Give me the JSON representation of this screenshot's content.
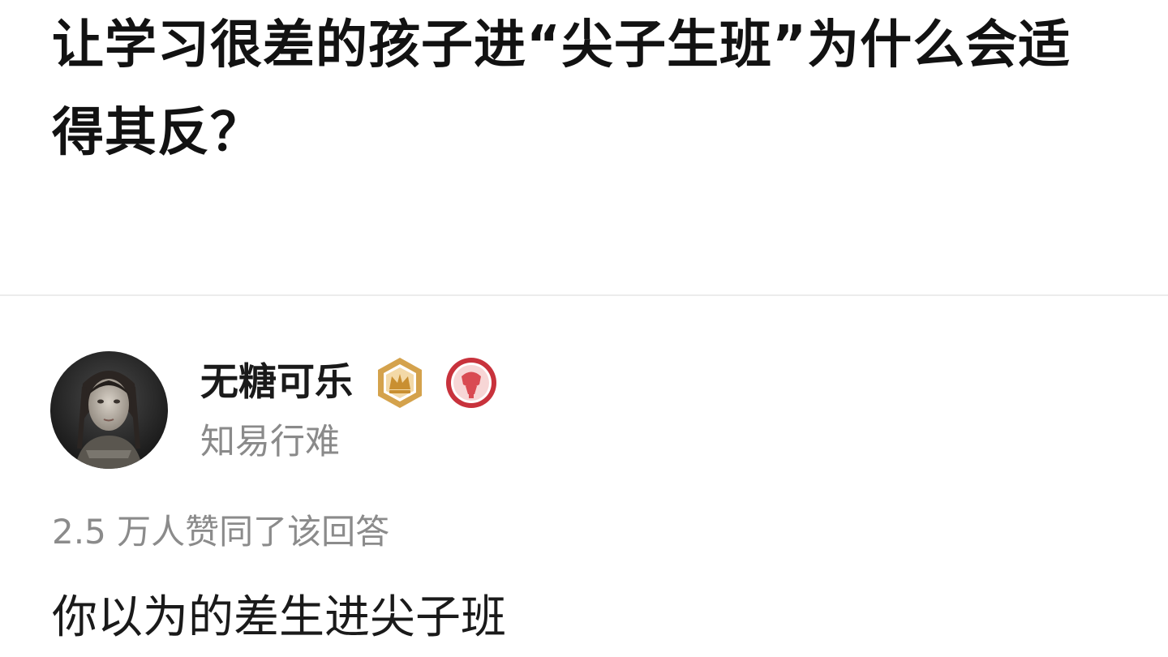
{
  "question": {
    "title": "让学习很差的孩子进“尖子生班”为什么会适得其反？"
  },
  "author": {
    "name": "无糖可乐",
    "headline": "知易行难",
    "badges": [
      "crown-badge-icon",
      "microphone-badge-icon"
    ],
    "badge_colors": {
      "crown": "#d4a24c",
      "microphone": "#c8323c"
    }
  },
  "answer": {
    "votes_text": "2.5 万人赞同了该回答",
    "first_line": "你以为的差生进尖子班"
  },
  "colors": {
    "title": "#121212",
    "muted": "#8a8a8a",
    "divider": "#ececec"
  }
}
